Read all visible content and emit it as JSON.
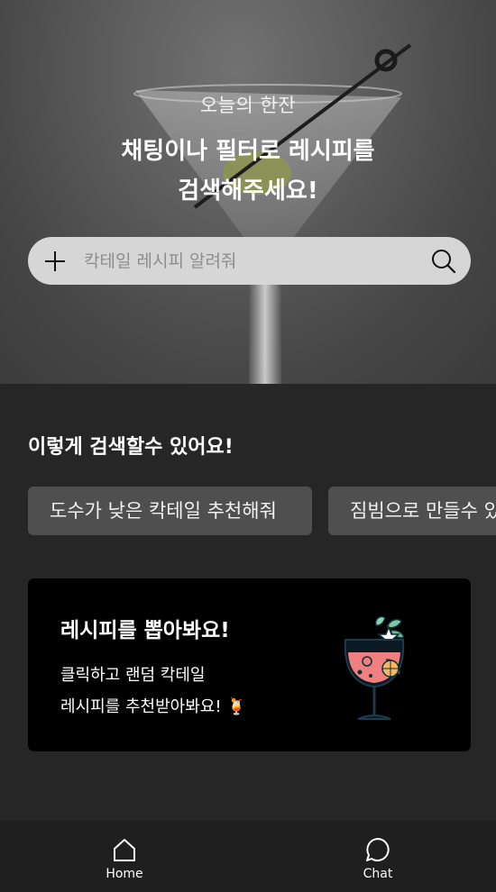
{
  "hero": {
    "subtitle": "오늘의 한잔",
    "title_line1": "채팅이나 필터로 레시피를",
    "title_line2": "검색해주세요!"
  },
  "search": {
    "placeholder": "칵테일 레시피 알려줘",
    "value": ""
  },
  "examples": {
    "title": "이렇게 검색할수 있어요!",
    "chips": [
      "도수가 낮은 칵테일 추천해줘",
      "짐빔으로 만들수 있는"
    ]
  },
  "random_card": {
    "title": "레시피를 뽑아봐요!",
    "line1": "클릭하고 랜덤 칵테일",
    "line2": "레시피를 추천받아봐요! 🍹"
  },
  "nav": {
    "home": "Home",
    "chat": "Chat"
  },
  "icons": {
    "add": "plus-icon",
    "search": "search-icon",
    "home": "home-icon",
    "chat": "chat-icon"
  }
}
